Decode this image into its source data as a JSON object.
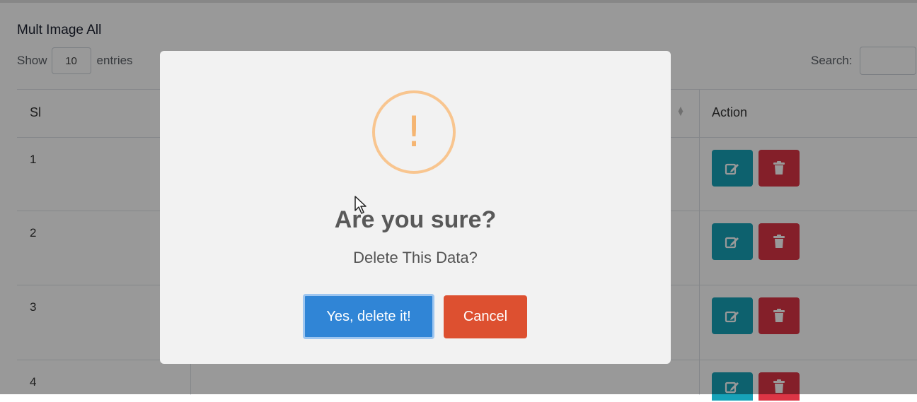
{
  "card": {
    "title": "Mult Image All"
  },
  "length_menu": {
    "show_label": "Show",
    "value": "10",
    "entries_label": "entries"
  },
  "search": {
    "label": "Search:",
    "value": ""
  },
  "table": {
    "headers": {
      "sl": "Sl",
      "action": "Action"
    },
    "rows": [
      {
        "sl": "1"
      },
      {
        "sl": "2"
      },
      {
        "sl": "3"
      },
      {
        "sl": "4"
      }
    ]
  },
  "icons": {
    "edit": "edit-icon",
    "delete": "trash-icon",
    "sort": "sort-icon",
    "warning": "warning-icon"
  },
  "colors": {
    "edit": "#17a2b8",
    "delete": "#dc3545",
    "confirm": "#3085d6",
    "cancel": "#dd5030",
    "warning": "#f8bb86"
  },
  "modal": {
    "icon_glyph": "!",
    "title": "Are you sure?",
    "text": "Delete This Data?",
    "confirm_label": "Yes, delete it!",
    "cancel_label": "Cancel"
  }
}
